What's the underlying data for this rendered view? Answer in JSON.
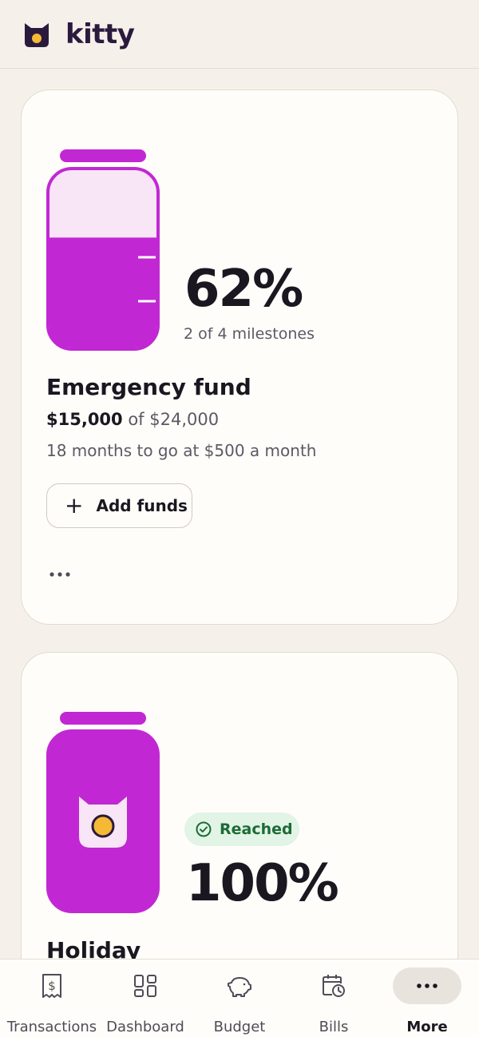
{
  "app": {
    "name": "kitty"
  },
  "colors": {
    "accent": "#c128d3",
    "accent_light": "#f8e5f6",
    "success_bg": "#e1f4e6",
    "success_text": "#1c6b35",
    "cat_eye": "#f5b935"
  },
  "goals": [
    {
      "name": "Emergency fund",
      "percent": "62%",
      "fill_fraction": 0.62,
      "milestones": "2 of 4 milestones",
      "saved": "$15,000",
      "of_target": " of $24,000",
      "plan": "18 months to go at $500 a month",
      "add_label": "Add funds",
      "add_icon": "plus-icon",
      "more_icon": "more-horizontal-icon"
    },
    {
      "name": "Holiday",
      "percent": "100%",
      "fill_fraction": 1.0,
      "badge": "Reached",
      "badge_icon": "check-circle-icon"
    }
  ],
  "nav": {
    "items": [
      {
        "label": "Transactions",
        "icon": "receipt-dollar-icon"
      },
      {
        "label": "Dashboard",
        "icon": "dashboard-grid-icon"
      },
      {
        "label": "Budget",
        "icon": "piggy-bank-icon"
      },
      {
        "label": "Bills",
        "icon": "calendar-clock-icon"
      },
      {
        "label": "More",
        "icon": "more-horizontal-icon",
        "active": true
      }
    ]
  }
}
